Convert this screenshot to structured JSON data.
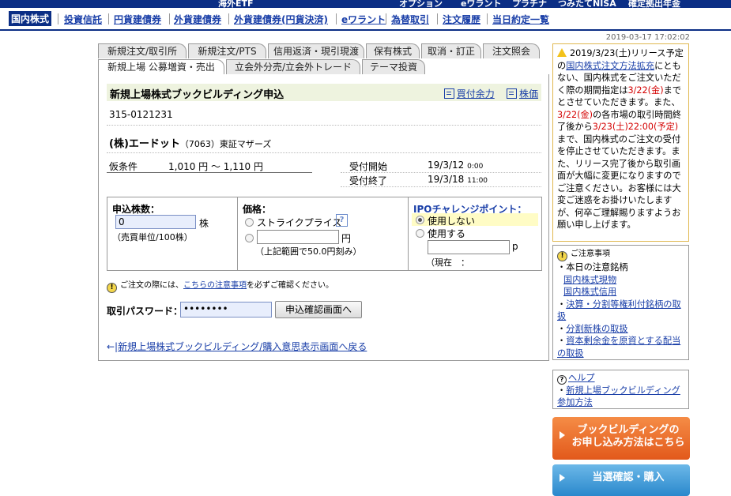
{
  "topnav": {
    "items": [
      "海外ETF",
      "オプション",
      "eワラント",
      "プラチナ",
      "つみたてNISA",
      "確定拠出年金"
    ]
  },
  "submenu": {
    "items": [
      "国内株式",
      "投資信託",
      "円貨建債券",
      "外貨建債券",
      "外貨建債券(円貨決済)",
      "eワラント",
      "為替取引",
      "注文履歴",
      "当日約定一覧"
    ],
    "active_index": 0
  },
  "datetime": "2019-03-17 17:02:02",
  "tabs_row1": [
    "新規注文/取引所",
    "新規注文/PTS",
    "信用返済・現引現渡",
    "保有株式",
    "取消・訂正",
    "注文照会"
  ],
  "tabs_row2": [
    "新規上場 公募増資・売出",
    "立会外分売/立会外トレード",
    "テーマ投資"
  ],
  "tabs_row2_active": 0,
  "main": {
    "title": "新規上場株式ブックビルディング申込",
    "link_buying_power": "買付余力",
    "link_price": "株価",
    "account_code": "315-0121231",
    "stock_name": "(株)エードット",
    "stock_code": "（7063）東証マザーズ",
    "provisional_label": "仮条件",
    "provisional_value": "1,010 円 ～ 1,110 円",
    "accept_start_label": "受付開始",
    "accept_start_date": "19/3/12",
    "accept_start_time": "0:00",
    "accept_end_label": "受付終了",
    "accept_end_date": "19/3/18",
    "accept_end_time": "11:00"
  },
  "form": {
    "qty_label": "申込株数：",
    "qty_value": "0",
    "qty_unit": "株",
    "qty_note": "（売買単位/100株）",
    "price_label": "価格：",
    "strike_price": "ストライクプライス",
    "help_q": "?",
    "price_unit": "円",
    "price_note": "（上記範囲で50.0円刻み）",
    "ipo_label": "IPOチャレンジポイント：",
    "ipo_opt_no": "使用しない",
    "ipo_opt_yes": "使用する",
    "ipo_unit": "p",
    "ipo_current": "（現在　："
  },
  "notice": {
    "prefix": "ご注文の際には、",
    "link": "こちらの注意事項",
    "suffix": "を必ずご確認ください。"
  },
  "password": {
    "label": "取引パスワード：",
    "value": "••••••••",
    "submit": "申込確認画面へ"
  },
  "back_link": "新規上場株式ブックビルディング/購入意思表示画面へ戻る",
  "alert": {
    "p1": "2019/3/23(土)リリース予定の",
    "link": "国内株式注文方法拡充",
    "p2": "にともない、国内株式をご注文いただく際の期間指定は",
    "r1": "3/22(金)",
    "p3": "までとさせていただきます。また、",
    "r2": "3/22(金)",
    "p4": "の各市場の取引時間終了後から",
    "r3": "3/23(土)22:00(予定)",
    "p5": "まで、国内株式のご注文の受付を停止させていただきます。また、リリース完了後から取引画面が大幅に変更になりますのでご注意ください。お客様には大変ご迷惑をお掛けいたしますが、何卒ご理解賜りますようお願い申し上げます。"
  },
  "notes": {
    "title": "ご注意事項",
    "items": [
      "本日の注意銘柄",
      "決算・分割等権利付銘柄の取扱",
      "分割新株の取扱",
      "資本剰余金を原資とする配当の取扱"
    ],
    "sub_links": [
      "国内株式現物",
      "国内株式信用"
    ]
  },
  "help": {
    "title": "ヘルプ",
    "item": "新規上場ブックビルディング参加方法"
  },
  "cta_orange": [
    "ブックビルディングの",
    "お申し込み方法はこちら"
  ],
  "cta_blue": "当選確認・購入"
}
